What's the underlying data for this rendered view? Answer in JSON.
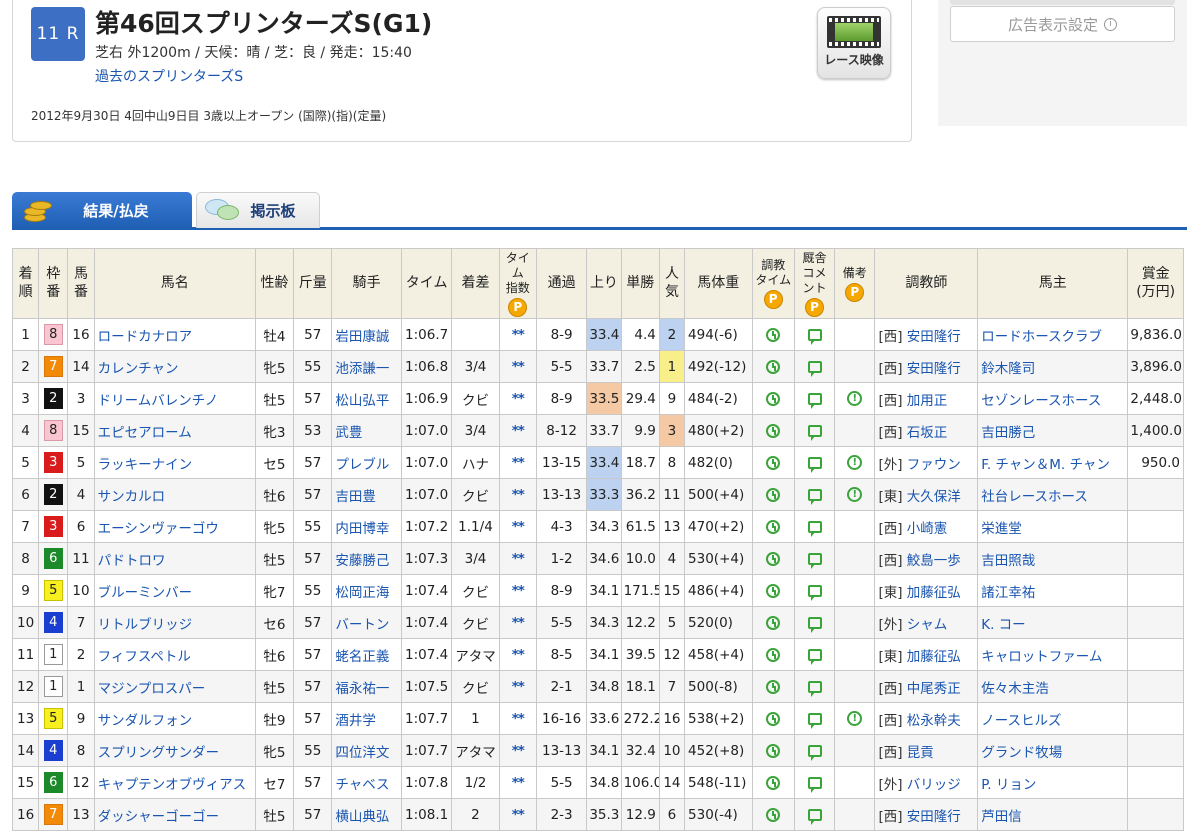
{
  "race": {
    "number": "11 R",
    "name": "第46回スプリンターズS(G1)",
    "info": "芝右 外1200m / 天候：晴 / 芝：良 / 発走：15:40",
    "past_link": "過去のスプリンターズS",
    "meta": "2012年9月30日 4回中山9日目 3歳以上オープン (国際)(指)(定量)",
    "video_label": "レース映像"
  },
  "ad": {
    "settings_label": "広告表示設定",
    "info_glyph": "i"
  },
  "tabs": {
    "result": "結果/払戻",
    "board": "掲示板"
  },
  "table": {
    "headers": {
      "rank": "着\n順",
      "waku": "枠\n番",
      "umaban": "馬\n番",
      "horse": "馬名",
      "sexage": "性齢",
      "weight": "斤量",
      "jockey": "騎手",
      "time": "タイム",
      "margin": "着差",
      "time_index": "タイム\n指数",
      "passing": "通過",
      "last3f": "上り",
      "odds": "単勝",
      "popularity": "人\n気",
      "body_weight": "馬体重",
      "training_time": "調教\nタイム",
      "stable_comment": "厩舎\nコメント",
      "notes": "備考",
      "trainer": "調教師",
      "owner": "馬主",
      "prize": "賞金\n(万円)"
    },
    "rows": [
      {
        "rank": "1",
        "waku": "8",
        "umaban": "16",
        "horse": "ロードカナロア",
        "sexage": "牡4",
        "weight": "57",
        "jockey": "岩田康誠",
        "time": "1:06.7",
        "margin": "",
        "index": "**",
        "passing": "8-9",
        "last3f": "33.4",
        "odds": "4.4",
        "pop": "2",
        "body": "494(-6)",
        "note": false,
        "region": "[西]",
        "trainer": "安田隆行",
        "owner": "ロードホースクラブ",
        "prize": "9,836.0"
      },
      {
        "rank": "2",
        "waku": "7",
        "umaban": "14",
        "horse": "カレンチャン",
        "sexage": "牝5",
        "weight": "55",
        "jockey": "池添謙一",
        "time": "1:06.8",
        "margin": "3/4",
        "index": "**",
        "passing": "5-5",
        "last3f": "33.7",
        "odds": "2.5",
        "pop": "1",
        "body": "492(-12)",
        "note": false,
        "region": "[西]",
        "trainer": "安田隆行",
        "owner": "鈴木隆司",
        "prize": "3,896.0"
      },
      {
        "rank": "3",
        "waku": "2",
        "umaban": "3",
        "horse": "ドリームバレンチノ",
        "sexage": "牡5",
        "weight": "57",
        "jockey": "松山弘平",
        "time": "1:06.9",
        "margin": "クビ",
        "index": "**",
        "passing": "8-9",
        "last3f": "33.5",
        "odds": "29.4",
        "pop": "9",
        "body": "484(-2)",
        "note": true,
        "region": "[西]",
        "trainer": "加用正",
        "owner": "セゾンレースホース",
        "prize": "2,448.0"
      },
      {
        "rank": "4",
        "waku": "8",
        "umaban": "15",
        "horse": "エピセアローム",
        "sexage": "牝3",
        "weight": "53",
        "jockey": "武豊",
        "time": "1:07.0",
        "margin": "3/4",
        "index": "**",
        "passing": "8-12",
        "last3f": "33.7",
        "odds": "9.9",
        "pop": "3",
        "body": "480(+2)",
        "note": false,
        "region": "[西]",
        "trainer": "石坂正",
        "owner": "吉田勝己",
        "prize": "1,400.0"
      },
      {
        "rank": "5",
        "waku": "3",
        "umaban": "5",
        "horse": "ラッキーナイン",
        "sexage": "セ5",
        "weight": "57",
        "jockey": "プレブル",
        "time": "1:07.0",
        "margin": "ハナ",
        "index": "**",
        "passing": "13-15",
        "last3f": "33.4",
        "odds": "18.7",
        "pop": "8",
        "body": "482(0)",
        "note": true,
        "region": "[外]",
        "trainer": "ファウン",
        "owner": "F. チャン＆M. チャン",
        "prize": "950.0"
      },
      {
        "rank": "6",
        "waku": "2",
        "umaban": "4",
        "horse": "サンカルロ",
        "sexage": "牡6",
        "weight": "57",
        "jockey": "吉田豊",
        "time": "1:07.0",
        "margin": "クビ",
        "index": "**",
        "passing": "13-13",
        "last3f": "33.3",
        "odds": "36.2",
        "pop": "11",
        "body": "500(+4)",
        "note": true,
        "region": "[東]",
        "trainer": "大久保洋",
        "owner": "社台レースホース",
        "prize": ""
      },
      {
        "rank": "7",
        "waku": "3",
        "umaban": "6",
        "horse": "エーシンヴァーゴウ",
        "sexage": "牝5",
        "weight": "55",
        "jockey": "内田博幸",
        "time": "1:07.2",
        "margin": "1.1/4",
        "index": "**",
        "passing": "4-3",
        "last3f": "34.3",
        "odds": "61.5",
        "pop": "13",
        "body": "470(+2)",
        "note": false,
        "region": "[西]",
        "trainer": "小崎憲",
        "owner": "栄進堂",
        "prize": ""
      },
      {
        "rank": "8",
        "waku": "6",
        "umaban": "11",
        "horse": "パドトロワ",
        "sexage": "牡5",
        "weight": "57",
        "jockey": "安藤勝己",
        "time": "1:07.3",
        "margin": "3/4",
        "index": "**",
        "passing": "1-2",
        "last3f": "34.6",
        "odds": "10.0",
        "pop": "4",
        "body": "530(+4)",
        "note": false,
        "region": "[西]",
        "trainer": "鮫島一歩",
        "owner": "吉田照哉",
        "prize": ""
      },
      {
        "rank": "9",
        "waku": "5",
        "umaban": "10",
        "horse": "ブルーミンバー",
        "sexage": "牝7",
        "weight": "55",
        "jockey": "松岡正海",
        "time": "1:07.4",
        "margin": "クビ",
        "index": "**",
        "passing": "8-9",
        "last3f": "34.1",
        "odds": "171.5",
        "pop": "15",
        "body": "486(+4)",
        "note": false,
        "region": "[東]",
        "trainer": "加藤征弘",
        "owner": "諸江幸祐",
        "prize": ""
      },
      {
        "rank": "10",
        "waku": "4",
        "umaban": "7",
        "horse": "リトルブリッジ",
        "sexage": "セ6",
        "weight": "57",
        "jockey": "バートン",
        "time": "1:07.4",
        "margin": "クビ",
        "index": "**",
        "passing": "5-5",
        "last3f": "34.3",
        "odds": "12.2",
        "pop": "5",
        "body": "520(0)",
        "note": false,
        "region": "[外]",
        "trainer": "シャム",
        "owner": "K. コー",
        "prize": ""
      },
      {
        "rank": "11",
        "waku": "1",
        "umaban": "2",
        "horse": "フィフスペトル",
        "sexage": "牡6",
        "weight": "57",
        "jockey": "蛯名正義",
        "time": "1:07.4",
        "margin": "アタマ",
        "index": "**",
        "passing": "8-5",
        "last3f": "34.1",
        "odds": "39.5",
        "pop": "12",
        "body": "458(+4)",
        "note": false,
        "region": "[東]",
        "trainer": "加藤征弘",
        "owner": "キャロットファーム",
        "prize": ""
      },
      {
        "rank": "12",
        "waku": "1",
        "umaban": "1",
        "horse": "マジンプロスパー",
        "sexage": "牡5",
        "weight": "57",
        "jockey": "福永祐一",
        "time": "1:07.5",
        "margin": "クビ",
        "index": "**",
        "passing": "2-1",
        "last3f": "34.8",
        "odds": "18.1",
        "pop": "7",
        "body": "500(-8)",
        "note": false,
        "region": "[西]",
        "trainer": "中尾秀正",
        "owner": "佐々木主浩",
        "prize": ""
      },
      {
        "rank": "13",
        "waku": "5",
        "umaban": "9",
        "horse": "サンダルフォン",
        "sexage": "牡9",
        "weight": "57",
        "jockey": "酒井学",
        "time": "1:07.7",
        "margin": "1",
        "index": "**",
        "passing": "16-16",
        "last3f": "33.6",
        "odds": "272.2",
        "pop": "16",
        "body": "538(+2)",
        "note": true,
        "region": "[西]",
        "trainer": "松永幹夫",
        "owner": "ノースヒルズ",
        "prize": ""
      },
      {
        "rank": "14",
        "waku": "4",
        "umaban": "8",
        "horse": "スプリングサンダー",
        "sexage": "牝5",
        "weight": "55",
        "jockey": "四位洋文",
        "time": "1:07.7",
        "margin": "アタマ",
        "index": "**",
        "passing": "13-13",
        "last3f": "34.1",
        "odds": "32.4",
        "pop": "10",
        "body": "452(+8)",
        "note": false,
        "region": "[西]",
        "trainer": "昆貢",
        "owner": "グランド牧場",
        "prize": ""
      },
      {
        "rank": "15",
        "waku": "6",
        "umaban": "12",
        "horse": "キャプテンオブヴィアス",
        "sexage": "セ7",
        "weight": "57",
        "jockey": "チャベス",
        "time": "1:07.8",
        "margin": "1/2",
        "index": "**",
        "passing": "5-5",
        "last3f": "34.8",
        "odds": "106.0",
        "pop": "14",
        "body": "548(-11)",
        "note": false,
        "region": "[外]",
        "trainer": "バリッジ",
        "owner": "P. リョン",
        "prize": ""
      },
      {
        "rank": "16",
        "waku": "7",
        "umaban": "13",
        "horse": "ダッシャーゴーゴー",
        "sexage": "牡5",
        "weight": "57",
        "jockey": "横山典弘",
        "time": "1:08.1",
        "margin": "2",
        "index": "**",
        "passing": "2-3",
        "last3f": "35.3",
        "odds": "12.9",
        "pop": "6",
        "body": "530(-4)",
        "note": false,
        "region": "[西]",
        "trainer": "安田隆行",
        "owner": "芦田信",
        "prize": ""
      }
    ]
  },
  "colors": {
    "accent": "#1f5fb4",
    "header_bg": "#f3f0e2",
    "icon_green": "#3aa33a",
    "premium": "#f6a800"
  }
}
